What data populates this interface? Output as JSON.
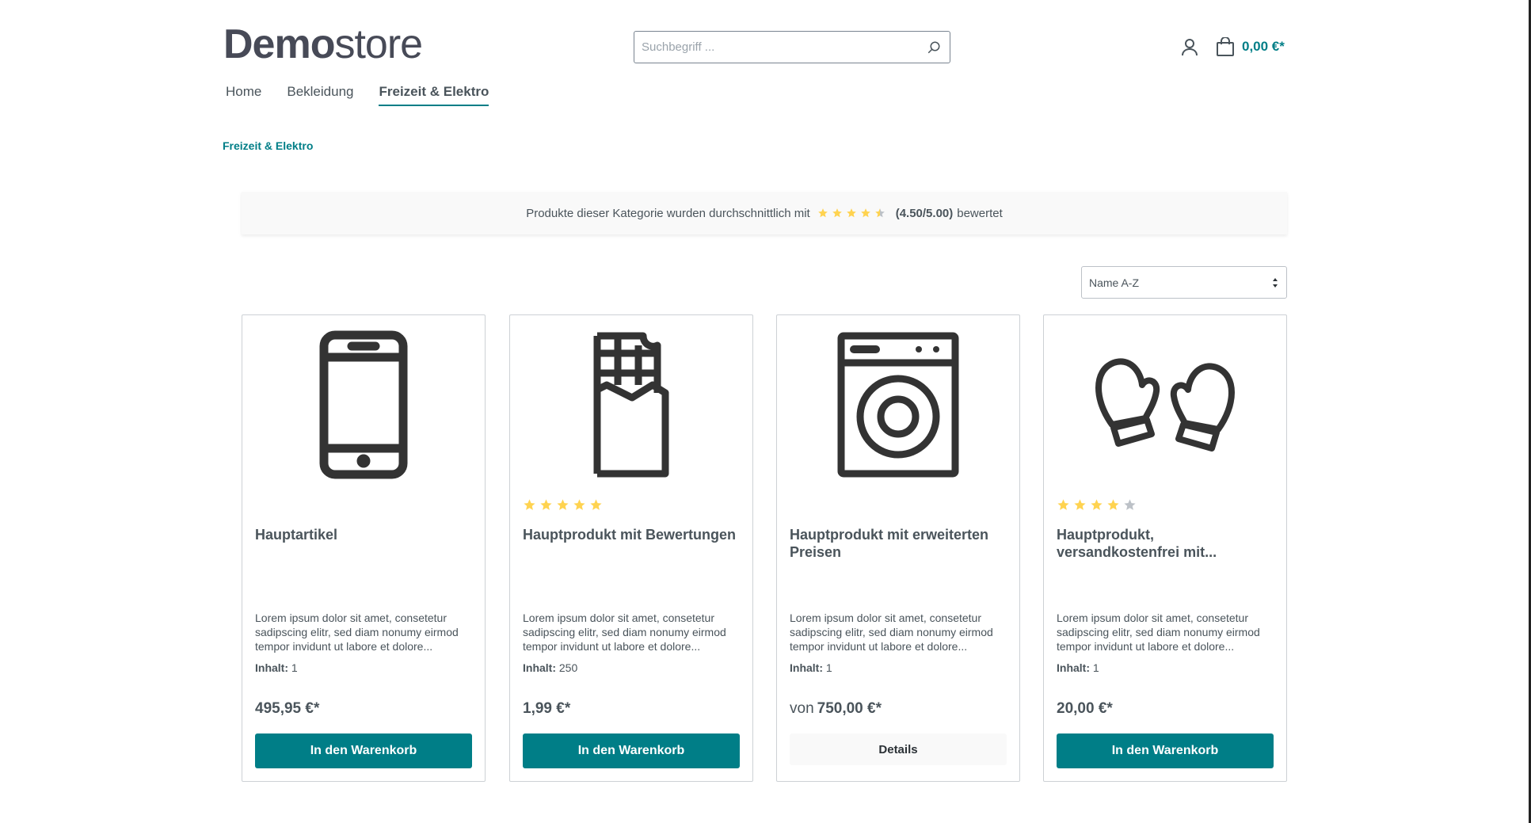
{
  "header": {
    "logo_bold": "Demo",
    "logo_light": "store",
    "search": {
      "placeholder": "Suchbegriff ..."
    },
    "cart_amount": "0,00 €*"
  },
  "nav": {
    "items": [
      {
        "label": "Home",
        "active": false
      },
      {
        "label": "Bekleidung",
        "active": false
      },
      {
        "label": "Freizeit & Elektro",
        "active": true
      }
    ]
  },
  "breadcrumb": "Freizeit & Elektro",
  "rating_banner": {
    "prefix": "Produkte dieser Kategorie wurden durchschnittlich mit",
    "score": "(4.50/5.00)",
    "suffix": "bewertet",
    "stars": 4.5
  },
  "sort": {
    "selected": "Name A-Z"
  },
  "colors": {
    "accent": "#007e87",
    "star": "#ffd350",
    "star_empty": "#bcc1c7",
    "text": "#4a545b"
  },
  "products": [
    {
      "icon": "smartphone-icon",
      "rating": null,
      "title": "Hauptartikel",
      "description": "Lorem ipsum dolor sit amet, consetetur sadipscing elitr, sed diam nonumy eirmod tempor invidunt ut labore et dolore...",
      "content_label": "Inhalt:",
      "content_value": "1",
      "price_prefix": "",
      "price": "495,95 €*",
      "button": "In den Warenkorb"
    },
    {
      "icon": "chocolate-bar-icon",
      "rating": 5,
      "title": "Hauptprodukt mit Bewertungen",
      "description": "Lorem ipsum dolor sit amet, consetetur sadipscing elitr, sed diam nonumy eirmod tempor invidunt ut labore et dolore...",
      "content_label": "Inhalt:",
      "content_value": "250",
      "price_prefix": "",
      "price": "1,99 €*",
      "button": "In den Warenkorb"
    },
    {
      "icon": "washing-machine-icon",
      "rating": null,
      "title": "Hauptprodukt mit erweiterten Preisen",
      "description": "Lorem ipsum dolor sit amet, consetetur sadipscing elitr, sed diam nonumy eirmod tempor invidunt ut labore et dolore...",
      "content_label": "Inhalt:",
      "content_value": "1",
      "price_prefix": "von",
      "price": "750,00 €*",
      "button": "Details"
    },
    {
      "icon": "mittens-icon",
      "rating": 4,
      "title": "Hauptprodukt, versandkostenfrei mit...",
      "description": "Lorem ipsum dolor sit amet, consetetur sadipscing elitr, sed diam nonumy eirmod tempor invidunt ut labore et dolore...",
      "content_label": "Inhalt:",
      "content_value": "1",
      "price_prefix": "",
      "price": "20,00 €*",
      "button": "In den Warenkorb"
    }
  ]
}
